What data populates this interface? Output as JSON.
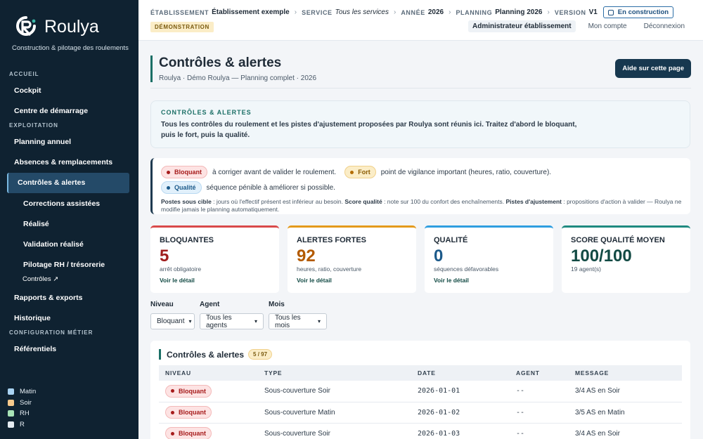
{
  "brand": {
    "name": "Roulya",
    "tagline": "Construction & pilotage des roulements"
  },
  "sidebar": {
    "sections": {
      "accueil": "ACCUEIL",
      "exploitation": "EXPLOITATION",
      "config": "CONFIGURATION MÉTIER"
    },
    "items": {
      "cockpit": "Cockpit",
      "demarrage": "Centre de démarrage",
      "planning": "Planning annuel",
      "absences": "Absences & remplacements",
      "controles": "Contrôles & alertes",
      "corrections": "Corrections assistées",
      "realise": "Réalisé",
      "validation": "Validation réalisé",
      "pilotage": "Pilotage RH / trésorerie",
      "controles_sub": "Contrôles ↗",
      "rapports": "Rapports & exports",
      "historique": "Historique",
      "referentiels": "Référentiels"
    },
    "legend": [
      {
        "label": "Matin",
        "color": "#a9d3f2"
      },
      {
        "label": "Soir",
        "color": "#f6c98c"
      },
      {
        "label": "RH",
        "color": "#a8e3b6"
      },
      {
        "label": "R",
        "color": "#e4ebf1"
      }
    ]
  },
  "topbar": {
    "crumbs": [
      {
        "k": "ÉTABLISSEMENT",
        "v": "Établissement exemple",
        "italic": false
      },
      {
        "k": "SERVICE",
        "v": "Tous les services",
        "italic": true
      },
      {
        "k": "ANNÉE",
        "v": "2026",
        "italic": false
      },
      {
        "k": "PLANNING",
        "v": "Planning 2026",
        "italic": false
      },
      {
        "k": "VERSION",
        "v": "V1",
        "italic": false
      }
    ],
    "status": "En construction",
    "demo": "DÉMONSTRATION",
    "links": {
      "admin": "Administrateur établissement",
      "account": "Mon compte",
      "logout": "Déconnexion"
    }
  },
  "page": {
    "title": "Contrôles & alertes",
    "subtitle": "Roulya · Démo Roulya — Planning complet · 2026",
    "help": "Aide sur cette page"
  },
  "intro": {
    "title": "CONTRÔLES & ALERTES",
    "text": "Tous les contrôles du roulement et les pistes d'ajustement proposées par Roulya sont réunis ici. Traitez d'abord le bloquant, puis le fort, puis la qualité."
  },
  "legendbox": {
    "bloquant": "Bloquant",
    "bloquant_desc": "à corriger avant de valider le roulement.",
    "fort": "Fort",
    "fort_desc": "point de vigilance important (heures, ratio, couverture).",
    "qualite": "Qualité",
    "qualite_desc": "séquence pénible à améliorer si possible.",
    "n1": "Postes sous cible",
    "n2": " : jours où l'effectif présent est inférieur au besoin. ",
    "n3": "Score qualité",
    "n4": " : note sur 100 du confort des enchaînements. ",
    "n5": "Pistes d'ajustement",
    "n6": " : propositions d'action à valider — Roulya ne modifie jamais le planning automatiquement."
  },
  "cards": [
    {
      "title": "BLOQUANTES",
      "value": "5",
      "sub": "arrêt obligatoire",
      "link": "Voir le détail",
      "color": "#d94a4a",
      "vcolor": "#a01d1d"
    },
    {
      "title": "ALERTES FORTES",
      "value": "92",
      "sub": "heures, ratio, couverture",
      "link": "Voir le détail",
      "color": "#e49a1b",
      "vcolor": "#b35a00"
    },
    {
      "title": "QUALITÉ",
      "value": "0",
      "sub": "séquences défavorables",
      "link": "Voir le détail",
      "color": "#2f9ee0",
      "vcolor": "#1c5a8a"
    },
    {
      "title": "SCORE QUALITÉ MOYEN",
      "value": "100/100",
      "sub": "19 agent(s)",
      "link": "",
      "color": "#1f8a80",
      "vcolor": "#124a44"
    }
  ],
  "filters": {
    "niveau_label": "Niveau",
    "niveau": "Bloquant",
    "agent_label": "Agent",
    "agent": "Tous les agents",
    "mois_label": "Mois",
    "mois": "Tous les mois"
  },
  "table": {
    "title": "Contrôles & alertes",
    "count": "5 / 97",
    "headers": [
      "NIVEAU",
      "TYPE",
      "DATE",
      "AGENT",
      "MESSAGE"
    ],
    "rows": [
      {
        "niveau": "Bloquant",
        "type": "Sous-couverture Soir",
        "date": "2026-01-01",
        "agent": "--",
        "message": "3/4 AS en Soir"
      },
      {
        "niveau": "Bloquant",
        "type": "Sous-couverture Matin",
        "date": "2026-01-02",
        "agent": "--",
        "message": "3/5 AS en Matin"
      },
      {
        "niveau": "Bloquant",
        "type": "Sous-couverture Soir",
        "date": "2026-01-03",
        "agent": "--",
        "message": "3/4 AS en Soir"
      }
    ]
  }
}
